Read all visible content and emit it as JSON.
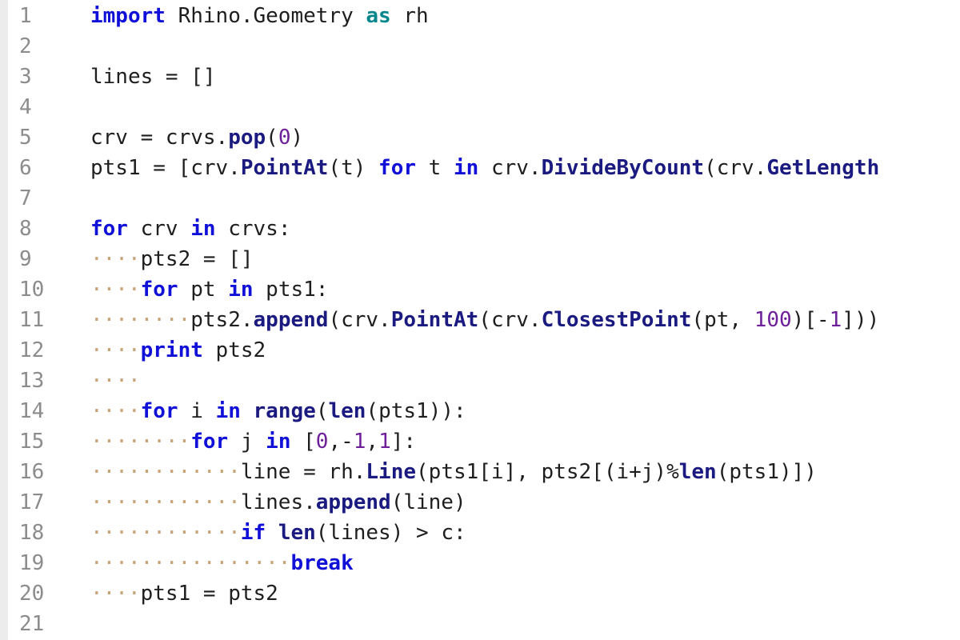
{
  "colors": {
    "background": "#ffffff",
    "gutter_bar": "#ececec",
    "line_number": "#8c8c8c",
    "keyword": "#1010d8",
    "keyword_alias": "#00868b",
    "method": "#1a1a80",
    "number": "#6e1f99",
    "whitespace_marker": "#c8a275",
    "text": "#1e1e1e"
  },
  "lines": [
    {
      "number": "1",
      "tokens": [
        {
          "t": "kw",
          "v": "import"
        },
        {
          "t": "text",
          "v": " Rhino.Geometry "
        },
        {
          "t": "kw2",
          "v": "as"
        },
        {
          "t": "text",
          "v": " rh"
        }
      ]
    },
    {
      "number": "2",
      "tokens": []
    },
    {
      "number": "3",
      "tokens": [
        {
          "t": "text",
          "v": "lines = []"
        }
      ]
    },
    {
      "number": "4",
      "tokens": []
    },
    {
      "number": "5",
      "tokens": [
        {
          "t": "text",
          "v": "crv = crvs."
        },
        {
          "t": "fn",
          "v": "pop"
        },
        {
          "t": "text",
          "v": "("
        },
        {
          "t": "num",
          "v": "0"
        },
        {
          "t": "text",
          "v": ")"
        }
      ]
    },
    {
      "number": "6",
      "tokens": [
        {
          "t": "text",
          "v": "pts1 = [crv."
        },
        {
          "t": "fn",
          "v": "PointAt"
        },
        {
          "t": "text",
          "v": "(t) "
        },
        {
          "t": "kw",
          "v": "for"
        },
        {
          "t": "text",
          "v": " t "
        },
        {
          "t": "kw",
          "v": "in"
        },
        {
          "t": "text",
          "v": " crv."
        },
        {
          "t": "fn",
          "v": "DivideByCount"
        },
        {
          "t": "text",
          "v": "(crv."
        },
        {
          "t": "fn",
          "v": "GetLength"
        }
      ]
    },
    {
      "number": "7",
      "tokens": []
    },
    {
      "number": "8",
      "tokens": [
        {
          "t": "kw",
          "v": "for"
        },
        {
          "t": "text",
          "v": " crv "
        },
        {
          "t": "kw",
          "v": "in"
        },
        {
          "t": "text",
          "v": " crvs:"
        }
      ]
    },
    {
      "number": "9",
      "tokens": [
        {
          "t": "ws",
          "v": "····"
        },
        {
          "t": "text",
          "v": "pts2 = []"
        }
      ]
    },
    {
      "number": "10",
      "tokens": [
        {
          "t": "ws",
          "v": "····"
        },
        {
          "t": "kw",
          "v": "for"
        },
        {
          "t": "text",
          "v": " pt "
        },
        {
          "t": "kw",
          "v": "in"
        },
        {
          "t": "text",
          "v": " pts1:"
        }
      ]
    },
    {
      "number": "11",
      "tokens": [
        {
          "t": "ws",
          "v": "········"
        },
        {
          "t": "text",
          "v": "pts2."
        },
        {
          "t": "fn",
          "v": "append"
        },
        {
          "t": "text",
          "v": "(crv."
        },
        {
          "t": "fn",
          "v": "PointAt"
        },
        {
          "t": "text",
          "v": "(crv."
        },
        {
          "t": "fn",
          "v": "ClosestPoint"
        },
        {
          "t": "text",
          "v": "(pt, "
        },
        {
          "t": "num",
          "v": "100"
        },
        {
          "t": "text",
          "v": ")[-"
        },
        {
          "t": "num",
          "v": "1"
        },
        {
          "t": "text",
          "v": "]))"
        }
      ]
    },
    {
      "number": "12",
      "tokens": [
        {
          "t": "ws",
          "v": "····"
        },
        {
          "t": "kw",
          "v": "print"
        },
        {
          "t": "text",
          "v": " pts2"
        }
      ]
    },
    {
      "number": "13",
      "tokens": [
        {
          "t": "ws",
          "v": "····"
        }
      ]
    },
    {
      "number": "14",
      "tokens": [
        {
          "t": "ws",
          "v": "····"
        },
        {
          "t": "kw",
          "v": "for"
        },
        {
          "t": "text",
          "v": " i "
        },
        {
          "t": "kw",
          "v": "in"
        },
        {
          "t": "text",
          "v": " "
        },
        {
          "t": "fn",
          "v": "range"
        },
        {
          "t": "text",
          "v": "("
        },
        {
          "t": "fn",
          "v": "len"
        },
        {
          "t": "text",
          "v": "(pts1)):"
        }
      ]
    },
    {
      "number": "15",
      "tokens": [
        {
          "t": "ws",
          "v": "········"
        },
        {
          "t": "kw",
          "v": "for"
        },
        {
          "t": "text",
          "v": " j "
        },
        {
          "t": "kw",
          "v": "in"
        },
        {
          "t": "text",
          "v": " ["
        },
        {
          "t": "num",
          "v": "0"
        },
        {
          "t": "text",
          "v": ",-"
        },
        {
          "t": "num",
          "v": "1"
        },
        {
          "t": "text",
          "v": ","
        },
        {
          "t": "num",
          "v": "1"
        },
        {
          "t": "text",
          "v": "]:"
        }
      ]
    },
    {
      "number": "16",
      "tokens": [
        {
          "t": "ws",
          "v": "············"
        },
        {
          "t": "text",
          "v": "line = rh."
        },
        {
          "t": "fn",
          "v": "Line"
        },
        {
          "t": "text",
          "v": "(pts1[i], pts2[(i+j)%"
        },
        {
          "t": "fn",
          "v": "len"
        },
        {
          "t": "text",
          "v": "(pts1)])"
        }
      ]
    },
    {
      "number": "17",
      "tokens": [
        {
          "t": "ws",
          "v": "············"
        },
        {
          "t": "text",
          "v": "lines."
        },
        {
          "t": "fn",
          "v": "append"
        },
        {
          "t": "text",
          "v": "(line)"
        }
      ]
    },
    {
      "number": "18",
      "tokens": [
        {
          "t": "ws",
          "v": "············"
        },
        {
          "t": "kw",
          "v": "if"
        },
        {
          "t": "text",
          "v": " "
        },
        {
          "t": "fn",
          "v": "len"
        },
        {
          "t": "text",
          "v": "(lines) > c:"
        }
      ]
    },
    {
      "number": "19",
      "tokens": [
        {
          "t": "ws",
          "v": "················"
        },
        {
          "t": "kw",
          "v": "break"
        }
      ]
    },
    {
      "number": "20",
      "tokens": [
        {
          "t": "ws",
          "v": "····"
        },
        {
          "t": "text",
          "v": "pts1 = pts2"
        }
      ]
    },
    {
      "number": "21",
      "tokens": []
    }
  ]
}
